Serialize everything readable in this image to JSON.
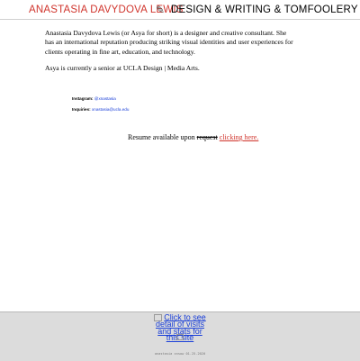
{
  "header": {
    "name": "ANASTASIA DAVYDOVA LEWIS",
    "separator_icon": "pencil-icon",
    "tagline": "DESIGN & WRITING & TOMFOOLERY",
    "colors": {
      "name": "#d0342c",
      "tagline": "#000000"
    }
  },
  "bio": {
    "paragraph_1": "Anastasia Davydova Lewis (or Asya for short) is a designer and creative consultant. She has an international reputation producing striking visual identities and user experiences for clients operating in fine art, education, and technology.",
    "paragraph_2": "Asya is currently a senior at UCLA Design | Media Arts."
  },
  "contacts": {
    "instagram_label": "Instagram:",
    "instagram_handle": "@xnastasia",
    "inquiries_label": "Inquiries:",
    "inquiries_email": "xnastasia@ucla.edu"
  },
  "resume": {
    "prefix": "Resume available upon",
    "struck_word": "request",
    "link_text": "clicking here."
  },
  "footer": {
    "counter_alt": "Click to see detail of visits and stats for this site",
    "copyright": "anastasia xnsow 01.25.2020"
  }
}
